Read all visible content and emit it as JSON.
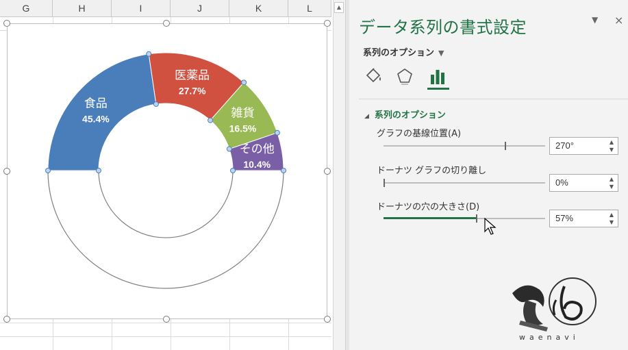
{
  "sheet": {
    "columns": [
      "G",
      "H",
      "I",
      "J",
      "K",
      "L"
    ]
  },
  "chart_data": {
    "type": "pie",
    "subtype": "doughnut",
    "first_slice_angle_deg": 270,
    "hole_size_pct": 57,
    "categories": [
      "食品",
      "医薬品",
      "雑貨",
      "その他"
    ],
    "values": [
      45.4,
      27.7,
      16.5,
      10.4
    ],
    "labels": [
      "45.4%",
      "27.7%",
      "16.5%",
      "10.4%"
    ],
    "colors": [
      "#4a7ebb",
      "#d0513f",
      "#98b954",
      "#7a5fa6"
    ],
    "hidden_half_fill": "#ffffff"
  },
  "pane": {
    "title": "データ系列の書式設定",
    "options_menu": "系列のオプション",
    "tabs": [
      "fill-line",
      "effects",
      "series-options"
    ],
    "section_header": "系列のオプション",
    "options": [
      {
        "label": "グラフの基線位置(A)",
        "value": "270°",
        "level": 0.75
      },
      {
        "label": "ドーナツ グラフの切り離し",
        "value": "0%",
        "level": 0.0
      },
      {
        "label": "ドーナツの穴の大きさ(D)",
        "value": "57%",
        "level": 0.57
      }
    ]
  },
  "logo": {
    "text": "waenavi"
  },
  "icons": {
    "dropdown": "▼",
    "close": "×",
    "spin_up": "▲",
    "spin_down": "▼",
    "collapse": "◢"
  }
}
